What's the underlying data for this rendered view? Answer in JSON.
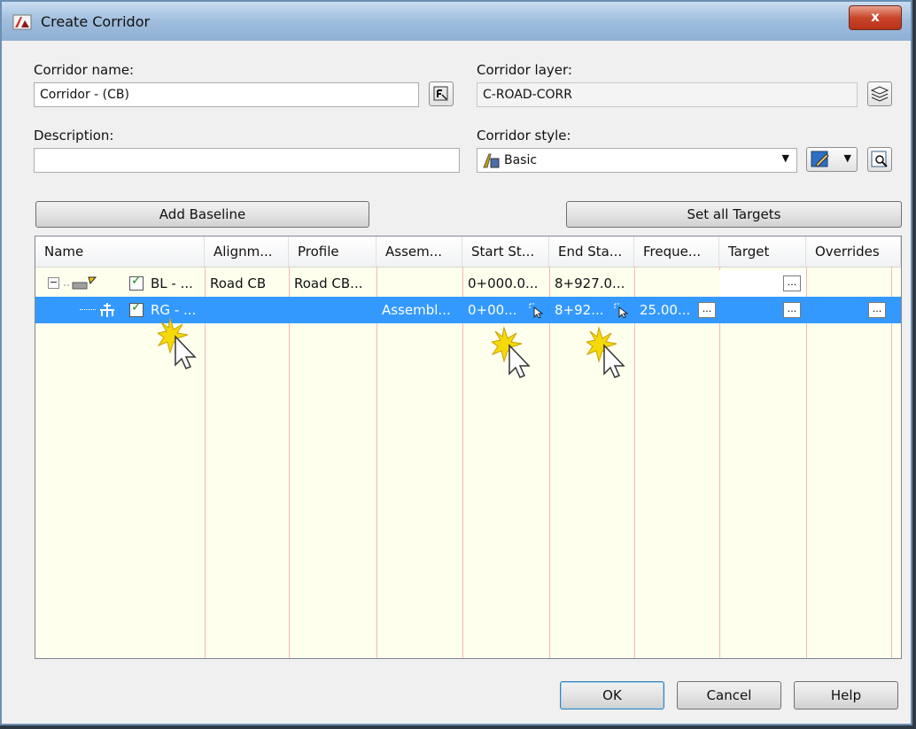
{
  "window": {
    "title": "Create Corridor",
    "close_label": "x"
  },
  "form": {
    "corridor_name_label": "Corridor name:",
    "corridor_name_value": "Corridor - (CB)",
    "corridor_layer_label": "Corridor layer:",
    "corridor_layer_value": "C-ROAD-CORR",
    "description_label": "Description:",
    "description_value": "",
    "corridor_style_label": "Corridor style:",
    "corridor_style_value": "Basic"
  },
  "toolbar": {
    "add_baseline": "Add Baseline",
    "set_all_targets": "Set all Targets"
  },
  "grid": {
    "columns": [
      "Name",
      "Alignm...",
      "Profile",
      "Assem...",
      "Start St...",
      "End Sta...",
      "Freque...",
      "Target",
      "Overrides"
    ],
    "rows": [
      {
        "name": "BL - ...",
        "alignment": "Road CB",
        "profile": "Road CB...",
        "assembly": "",
        "start": "0+000.0...",
        "end": "8+927.0...",
        "frequency": "",
        "checked": true
      },
      {
        "name": "RG - ...",
        "alignment": "",
        "profile": "",
        "assembly": "Assembl...",
        "start": "0+00...",
        "end": "8+92...",
        "frequency": "25.00...",
        "checked": true,
        "selected": true
      }
    ],
    "ellipsis": "..."
  },
  "footer": {
    "ok": "OK",
    "cancel": "Cancel",
    "help": "Help"
  },
  "colors": {
    "selection": "#3399ff",
    "grid_bg": "#ffffee",
    "column_line": "#f3b7b7"
  }
}
